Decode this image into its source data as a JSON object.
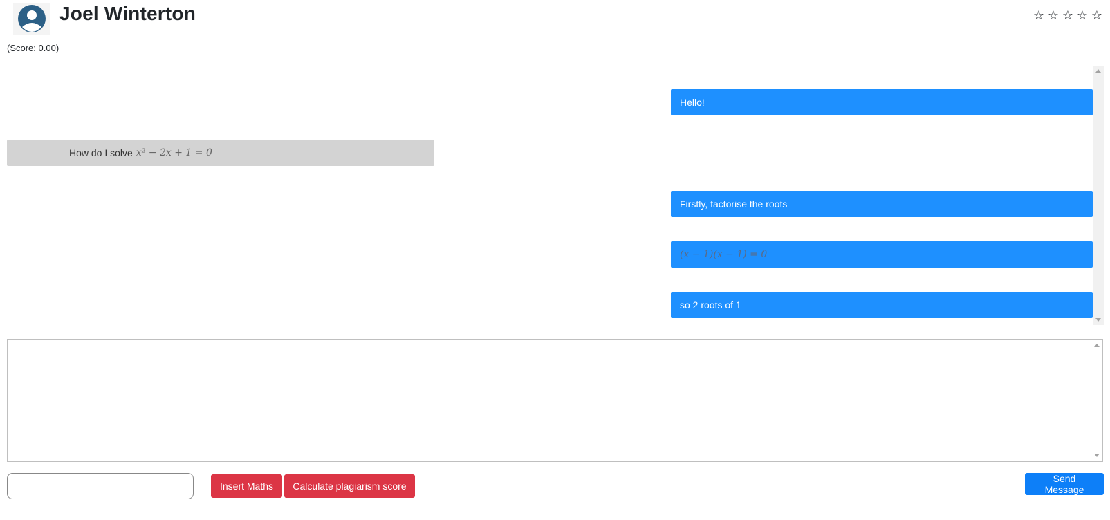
{
  "header": {
    "name": "Joel Winterton",
    "rating_stars": [
      "☆",
      "☆",
      "☆",
      "☆",
      "☆"
    ],
    "rating_value": 0,
    "rating_max": 5,
    "score_text": "(Score: 0.00)"
  },
  "messages": [
    {
      "side": "sent",
      "text": "Hello!"
    },
    {
      "side": "received",
      "text": "How do I solve",
      "math": "x² − 2x + 1 = 0"
    },
    {
      "side": "sent",
      "text": "Firstly, factorise the roots"
    },
    {
      "side": "sent",
      "math": "(x − 1)(x − 1) = 0"
    },
    {
      "side": "sent",
      "text": "so 2 roots of 1"
    }
  ],
  "composer": {
    "textarea_value": "",
    "small_input_value": "",
    "insert_maths_label": "Insert Maths",
    "plagiarism_label": "Calculate plagiarism score",
    "send_label": "Send Message"
  },
  "colors": {
    "sent_bubble": "#1e90ff",
    "received_bubble": "#d3d3d3",
    "danger_button": "#dc3545",
    "primary_button": "#0d7ff8"
  }
}
